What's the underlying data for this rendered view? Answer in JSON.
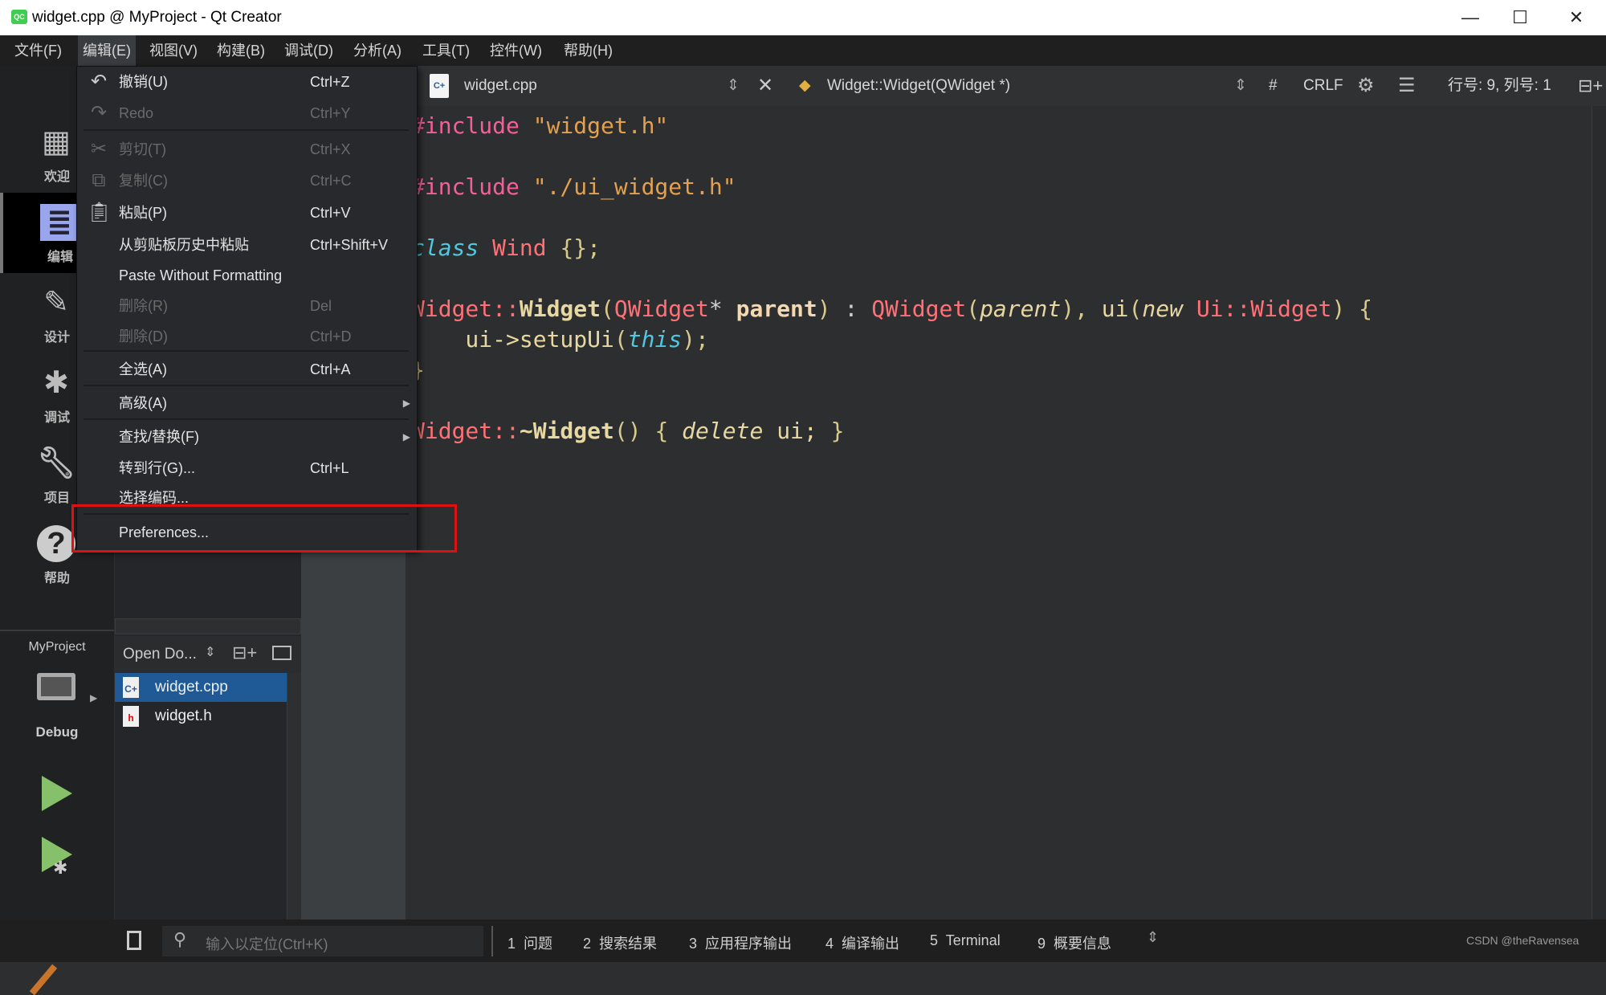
{
  "window": {
    "title": "widget.cpp @ MyProject - Qt Creator",
    "logo": "QC",
    "minimize": "—",
    "maximize": "☐",
    "close": "✕"
  },
  "menubar": [
    "文件(F)",
    "编辑(E)",
    "视图(V)",
    "构建(B)",
    "调试(D)",
    "分析(A)",
    "工具(T)",
    "控件(W)",
    "帮助(H)"
  ],
  "modes": [
    {
      "label": "欢迎",
      "icon": "grid-icon"
    },
    {
      "label": "编辑",
      "icon": "edit-doc-icon",
      "active": true
    },
    {
      "label": "设计",
      "icon": "pencil-icon"
    },
    {
      "label": "调试",
      "icon": "bug-icon"
    },
    {
      "label": "项目",
      "icon": "wrench-icon"
    },
    {
      "label": "帮助",
      "icon": "help-icon"
    }
  ],
  "target": {
    "project": "MyProject",
    "config": "Debug"
  },
  "open_docs": {
    "selector": "Open Do...",
    "items": [
      {
        "name": "widget.cpp",
        "selected": true
      },
      {
        "name": "widget.h"
      }
    ]
  },
  "editor_toolbar": {
    "file": "widget.cpp",
    "symbol": "Widget::Widget(QWidget *)",
    "hash": "#",
    "line_ending": "CRLF",
    "position": "行号: 9, 列号: 1"
  },
  "code": [
    [
      [
        "pp",
        "#include "
      ],
      [
        "str",
        "\"widget.h\""
      ]
    ],
    [
      [
        "pp",
        "#include "
      ],
      [
        "str",
        "\"./ui_widget.h\""
      ]
    ],
    [
      [
        "kw",
        "class"
      ],
      [
        "op",
        " "
      ],
      [
        "type",
        "Wind"
      ],
      [
        "br",
        " {};"
      ]
    ],
    [
      [
        "type",
        "Widget::"
      ],
      [
        "fn",
        "Widget"
      ],
      [
        "br",
        "("
      ],
      [
        "type",
        "QWidget"
      ],
      [
        "op",
        "* "
      ],
      [
        "par",
        "parent"
      ],
      [
        "br",
        ")"
      ],
      [
        "op",
        " : "
      ],
      [
        "type",
        "QWidget"
      ],
      [
        "br",
        "("
      ],
      [
        "it",
        "parent"
      ],
      [
        "br",
        "),"
      ],
      [
        "pl",
        " ui"
      ],
      [
        "br",
        "("
      ],
      [
        "it",
        "new "
      ],
      [
        "type",
        "Ui::Widget"
      ],
      [
        "br",
        ") {"
      ]
    ],
    [
      [
        "pl",
        "    ui->setupUi"
      ],
      [
        "br",
        "("
      ],
      [
        "kw",
        "this"
      ],
      [
        "br",
        ");"
      ]
    ],
    [
      [
        "br",
        "}"
      ]
    ],
    [
      [
        "type",
        "Widget::"
      ],
      [
        "fn",
        "~Widget"
      ],
      [
        "br",
        "() { "
      ],
      [
        "it",
        "delete "
      ],
      [
        "pl",
        "ui; "
      ],
      [
        "br",
        "}"
      ]
    ]
  ],
  "edit_menu": [
    {
      "label": "撤销(U)",
      "shortcut": "Ctrl+Z",
      "icon": "undo-icon"
    },
    {
      "label": "Redo",
      "shortcut": "Ctrl+Y",
      "icon": "redo-icon",
      "disabled": true
    },
    {
      "label": "剪切(T)",
      "shortcut": "Ctrl+X",
      "icon": "scissors-icon",
      "disabled": true
    },
    {
      "label": "复制(C)",
      "shortcut": "Ctrl+C",
      "icon": "copy-icon",
      "disabled": true
    },
    {
      "label": "粘贴(P)",
      "shortcut": "Ctrl+V",
      "icon": "paste-icon"
    },
    {
      "label": "从剪贴板历史中粘贴",
      "shortcut": "Ctrl+Shift+V"
    },
    {
      "label": "Paste Without Formatting",
      "shortcut": ""
    },
    {
      "label": "删除(R)",
      "shortcut": "Del",
      "disabled": true
    },
    {
      "label": "删除(D)",
      "shortcut": "Ctrl+D",
      "disabled": true
    },
    {
      "label": "全选(A)",
      "shortcut": "Ctrl+A"
    },
    {
      "label": "高级(A)",
      "shortcut": "",
      "submenu": true
    },
    {
      "label": "查找/替换(F)",
      "shortcut": "",
      "submenu": true
    },
    {
      "label": "转到行(G)...",
      "shortcut": "Ctrl+L"
    },
    {
      "label": "选择编码...",
      "shortcut": ""
    },
    {
      "label": "Preferences...",
      "shortcut": "",
      "highlighted_box": true
    }
  ],
  "statusbar": {
    "locator_placeholder": "输入以定位(Ctrl+K)",
    "panes": [
      "1  问题",
      "2  搜索结果",
      "3  应用程序输出",
      "4  编译输出",
      "5  Terminal",
      "9  概要信息"
    ],
    "watermark": "CSDN @theRavensea"
  },
  "colors": {
    "highlight_box": "#e01010",
    "selection": "#1f5a96",
    "accent_run": "#86c06a"
  }
}
